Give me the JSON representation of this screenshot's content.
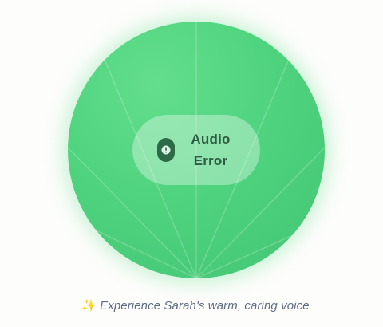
{
  "status": {
    "label_line1": "Audio",
    "label_line2": "Error",
    "icon": "exclamation-icon"
  },
  "caption": {
    "sparkle": "✨",
    "text": "Experience Sarah's warm, caring voice"
  },
  "colors": {
    "orb": "#4fd37e",
    "orb_light": "#63de8c",
    "icon_bg": "#2d6b48",
    "label": "#2e5d43",
    "caption": "#5f6c84",
    "background": "#fdfdfb"
  }
}
